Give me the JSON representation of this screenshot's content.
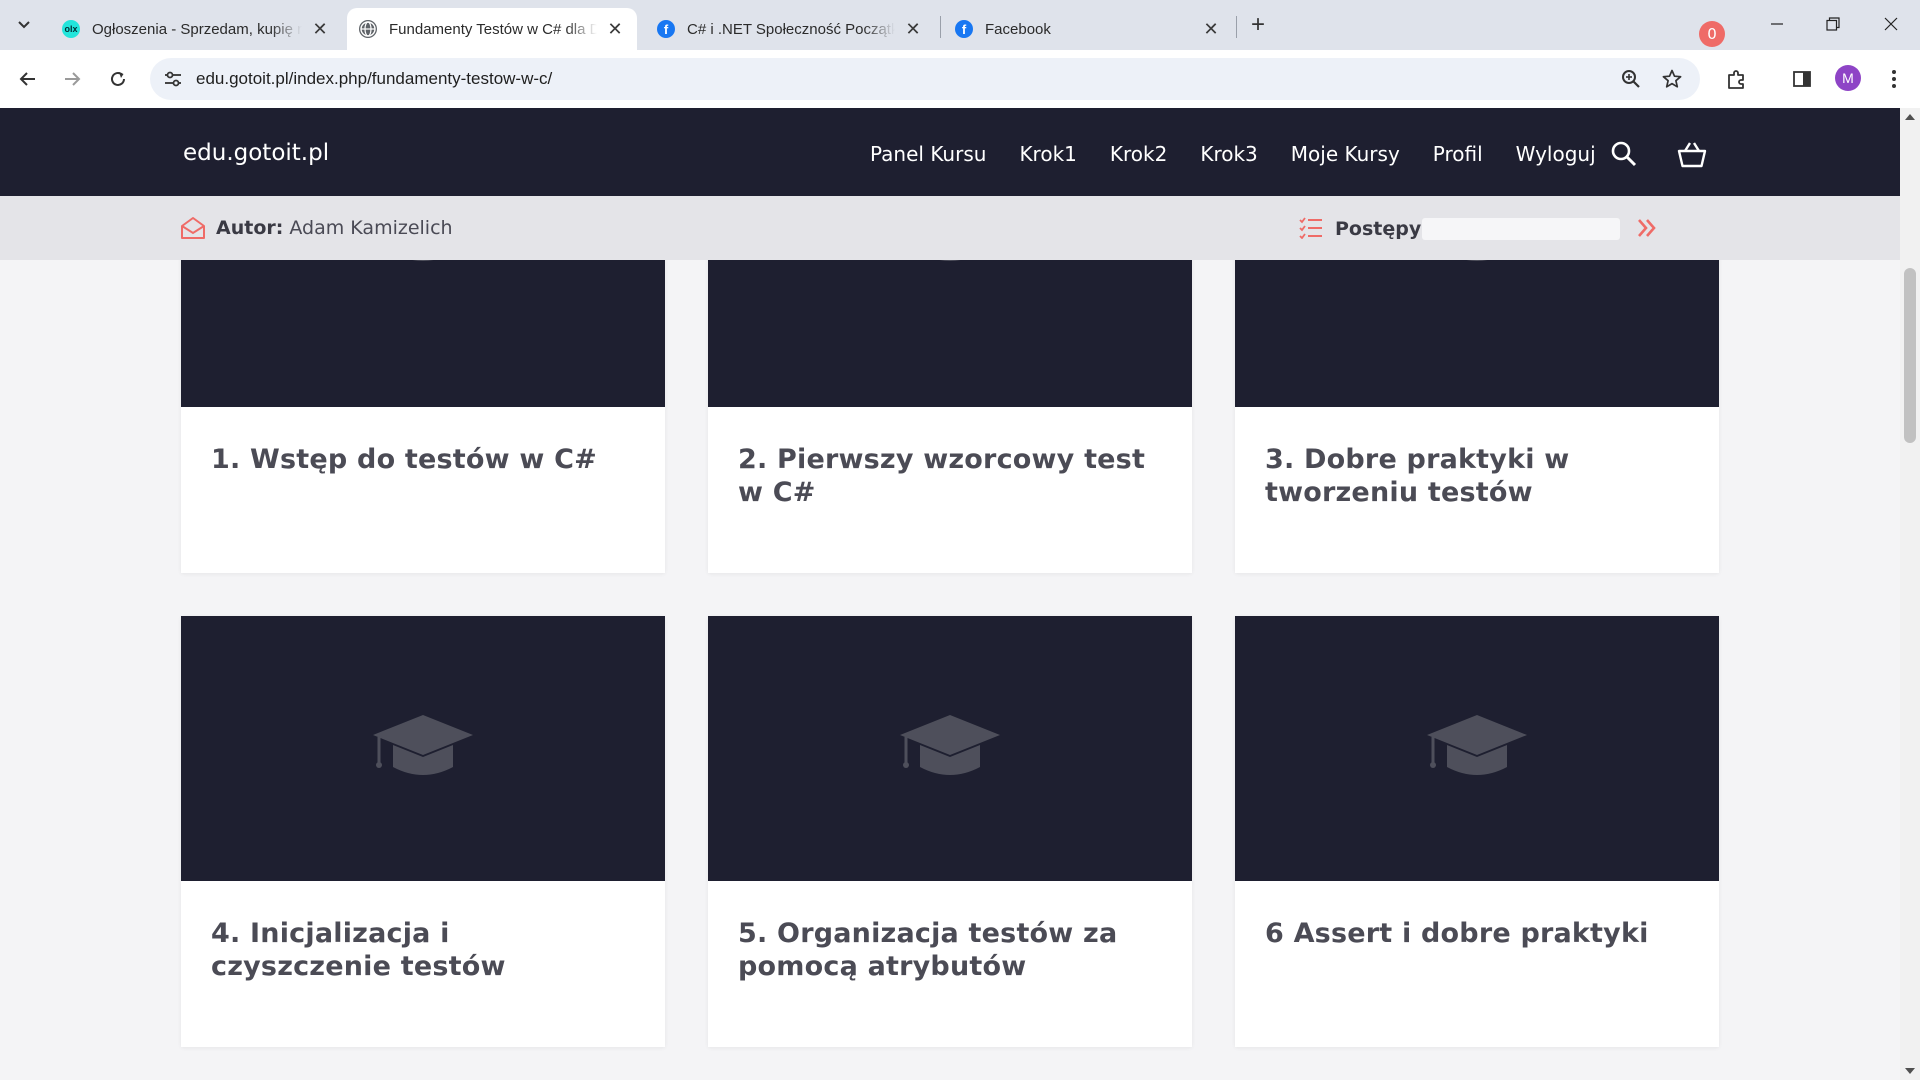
{
  "browser": {
    "tabs": [
      {
        "title": "Ogłoszenia - Sprzedam, kupię na OLX",
        "icon": "olx-icon",
        "active": false
      },
      {
        "title": "Fundamenty Testów w C# dla Developerów",
        "icon": "globe-icon",
        "active": true
      },
      {
        "title": "C# i .NET Społeczność Początkujących",
        "icon": "facebook-icon",
        "active": false
      },
      {
        "title": "Facebook",
        "icon": "facebook-icon",
        "active": false
      }
    ],
    "new_tab": "+",
    "url": "edu.gotoit.pl/index.php/fundamenty-testow-w-c/",
    "profile_initial": "M",
    "close_glyph": "✕"
  },
  "site": {
    "logo": "edu.gotoit.pl",
    "nav": [
      "Panel Kursu",
      "Krok1",
      "Krok2",
      "Krok3",
      "Moje Kursy",
      "Profil",
      "Wyloguj"
    ],
    "cart_count": "0",
    "author_label": "Autor:",
    "author_name": "Adam Kamizelich",
    "progress_label": "Postępy:",
    "progress_value": 0,
    "accent_color": "#ef6b67",
    "header_color": "#1e1f30"
  },
  "lessons": [
    {
      "title": "1. Wstęp do testów w C#"
    },
    {
      "title": "2. Pierwszy wzorcowy test w C#"
    },
    {
      "title": "3. Dobre praktyki w tworzeniu testów"
    },
    {
      "title": "4. Inicjalizacja i czyszczenie testów"
    },
    {
      "title": "5. Organizacja testów za pomocą atrybutów"
    },
    {
      "title": "6 Assert i dobre praktyki"
    }
  ]
}
